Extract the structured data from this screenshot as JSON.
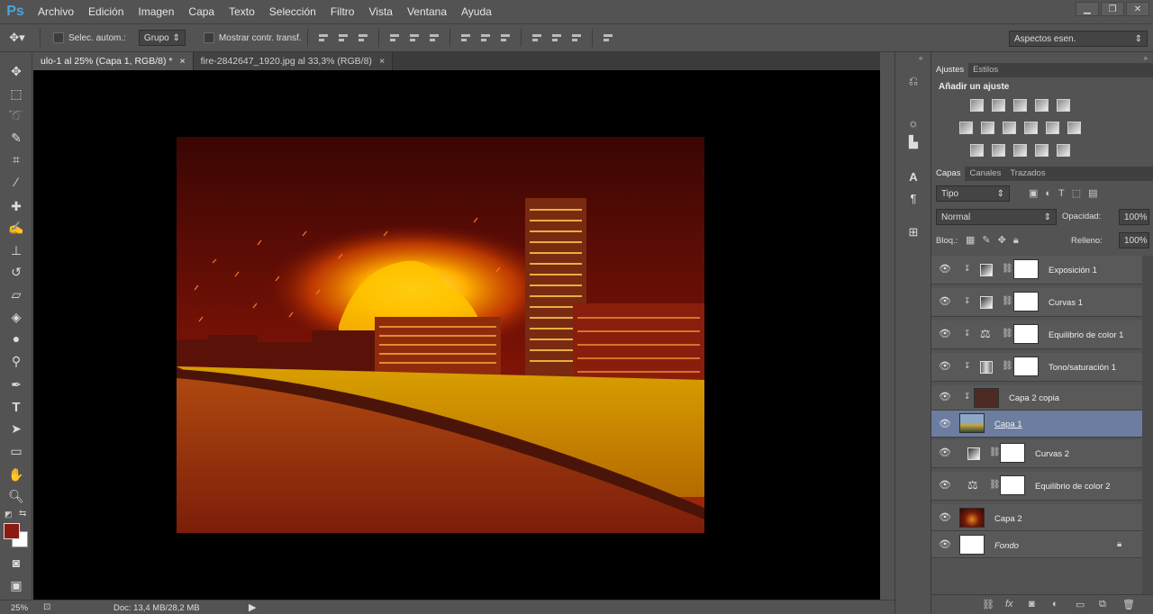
{
  "app": {
    "logo": "Ps"
  },
  "menu": [
    "Archivo",
    "Edición",
    "Imagen",
    "Capa",
    "Texto",
    "Selección",
    "Filtro",
    "Vista",
    "Ventana",
    "Ayuda"
  ],
  "window_controls": {
    "minimize": "▁",
    "restore": "❐",
    "close": "✕"
  },
  "options": {
    "auto_select_label": "Selec. autom.:",
    "auto_select_value": "Grupo",
    "transform_label": "Mostrar contr. transf.",
    "workspace": "Aspectos esen."
  },
  "doc_tabs": [
    {
      "label": "ulo-1 al 25% (Capa 1, RGB/8) *",
      "close": "×"
    },
    {
      "label": "fire-2842647_1920.jpg al 33,3% (RGB/8)",
      "close": "×"
    }
  ],
  "status": {
    "zoom": "25%",
    "doc": "Doc: 13,4 MB/28,2 MB"
  },
  "adjust_panel": {
    "tabs": [
      "Ajustes",
      "Estilos"
    ],
    "title": "Añadir un ajuste"
  },
  "layers_panel": {
    "tabs": [
      "Capas",
      "Canales",
      "Trazados"
    ],
    "filter": "Tipo",
    "blend_mode": "Normal",
    "opacity_label": "Opacidad:",
    "opacity_value": "100%",
    "lock_label": "Bloq.:",
    "fill_label": "Relleno:",
    "fill_value": "100%",
    "layers": [
      {
        "name": "Exposición 1"
      },
      {
        "name": "Curvas 1"
      },
      {
        "name": "Equilibrio de color 1"
      },
      {
        "name": "Tono/saturación 1"
      },
      {
        "name": "Capa 2 copia"
      },
      {
        "name": "Capa 1"
      },
      {
        "name": "Curvas 2"
      },
      {
        "name": "Equilibrio de color 2"
      },
      {
        "name": "Capa 2"
      },
      {
        "name": "Fondo"
      }
    ]
  },
  "colors": {
    "foreground": "#8b1a12",
    "background": "#ffffff",
    "selected_layer": "#6c7da0"
  }
}
